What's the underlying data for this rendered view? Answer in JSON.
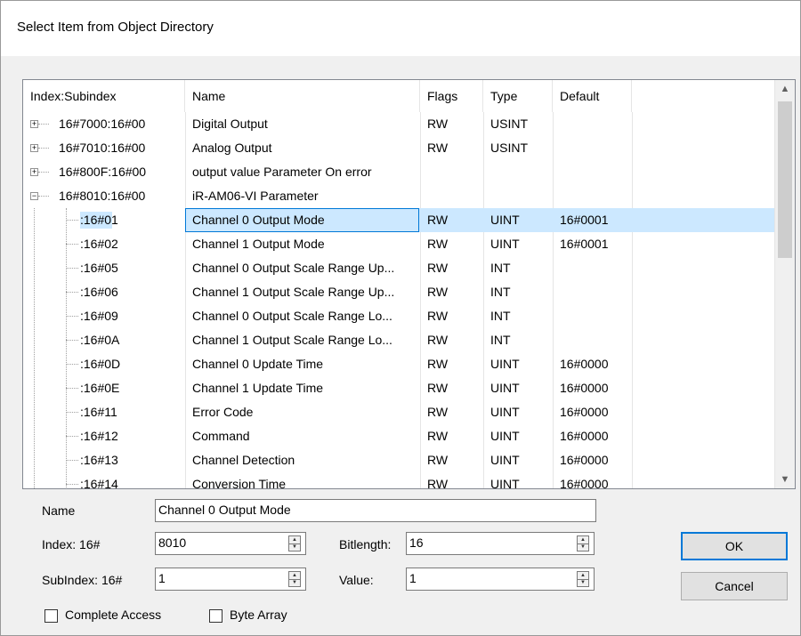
{
  "window": {
    "title": "Select Item from Object Directory"
  },
  "table": {
    "columns": [
      "Index:Subindex",
      "Name",
      "Flags",
      "Type",
      "Default"
    ],
    "rows": [
      {
        "index": "16#7000:16#00",
        "name": "Digital Output",
        "flags": "RW",
        "type": "USINT",
        "default": "",
        "level": 0,
        "expander": "+"
      },
      {
        "index": "16#7010:16#00",
        "name": "Analog Output",
        "flags": "RW",
        "type": "USINT",
        "default": "",
        "level": 0,
        "expander": "+"
      },
      {
        "index": "16#800F:16#00",
        "name": "output value Parameter On error",
        "flags": "",
        "type": "",
        "default": "",
        "level": 0,
        "expander": "+"
      },
      {
        "index": "16#8010:16#00",
        "name": "iR-AM06-VI Parameter",
        "flags": "",
        "type": "",
        "default": "",
        "level": 0,
        "expander": "-"
      },
      {
        "index": ":16#01",
        "name": "Channel 0 Output Mode",
        "flags": "RW",
        "type": "UINT",
        "default": "16#0001",
        "level": 1,
        "selected": true
      },
      {
        "index": ":16#02",
        "name": "Channel 1 Output Mode",
        "flags": "RW",
        "type": "UINT",
        "default": "16#0001",
        "level": 1
      },
      {
        "index": ":16#05",
        "name": "Channel 0 Output Scale Range Up...",
        "flags": "RW",
        "type": "INT",
        "default": "",
        "level": 1
      },
      {
        "index": ":16#06",
        "name": "Channel 1 Output Scale Range Up...",
        "flags": "RW",
        "type": "INT",
        "default": "",
        "level": 1
      },
      {
        "index": ":16#09",
        "name": "Channel 0 Output Scale Range Lo...",
        "flags": "RW",
        "type": "INT",
        "default": "",
        "level": 1
      },
      {
        "index": ":16#0A",
        "name": "Channel 1 Output Scale Range Lo...",
        "flags": "RW",
        "type": "INT",
        "default": "",
        "level": 1
      },
      {
        "index": ":16#0D",
        "name": "Channel 0 Update Time",
        "flags": "RW",
        "type": "UINT",
        "default": "16#0000",
        "level": 1
      },
      {
        "index": ":16#0E",
        "name": "Channel 1 Update Time",
        "flags": "RW",
        "type": "UINT",
        "default": "16#0000",
        "level": 1
      },
      {
        "index": ":16#11",
        "name": "Error Code",
        "flags": "RW",
        "type": "UINT",
        "default": "16#0000",
        "level": 1
      },
      {
        "index": ":16#12",
        "name": "Command",
        "flags": "RW",
        "type": "UINT",
        "default": "16#0000",
        "level": 1
      },
      {
        "index": ":16#13",
        "name": "Channel Detection",
        "flags": "RW",
        "type": "UINT",
        "default": "16#0000",
        "level": 1
      },
      {
        "index": ":16#14",
        "name": "Conversion Time",
        "flags": "RW",
        "type": "UINT",
        "default": "16#0000",
        "level": 1
      }
    ]
  },
  "form": {
    "name_label": "Name",
    "name_value": "Channel 0 Output Mode",
    "index_label": "Index: 16#",
    "index_value": "8010",
    "subindex_label": "SubIndex: 16#",
    "subindex_value": "1",
    "bitlength_label": "Bitlength:",
    "bitlength_value": "16",
    "value_label": "Value:",
    "value_value": "1",
    "complete_access_label": "Complete Access",
    "complete_access_checked": false,
    "byte_array_label": "Byte Array",
    "byte_array_checked": false
  },
  "buttons": {
    "ok": "OK",
    "cancel": "Cancel"
  },
  "colors": {
    "selection": "#cce8ff",
    "focus_border": "#0078d7",
    "dialog_bg": "#f0f0f0"
  },
  "icons": {
    "expand": "plus-box-icon",
    "collapse": "minus-box-icon",
    "scroll_up": "chevron-up-icon",
    "scroll_down": "chevron-down-icon",
    "spin": "spin-arrows-icon"
  }
}
